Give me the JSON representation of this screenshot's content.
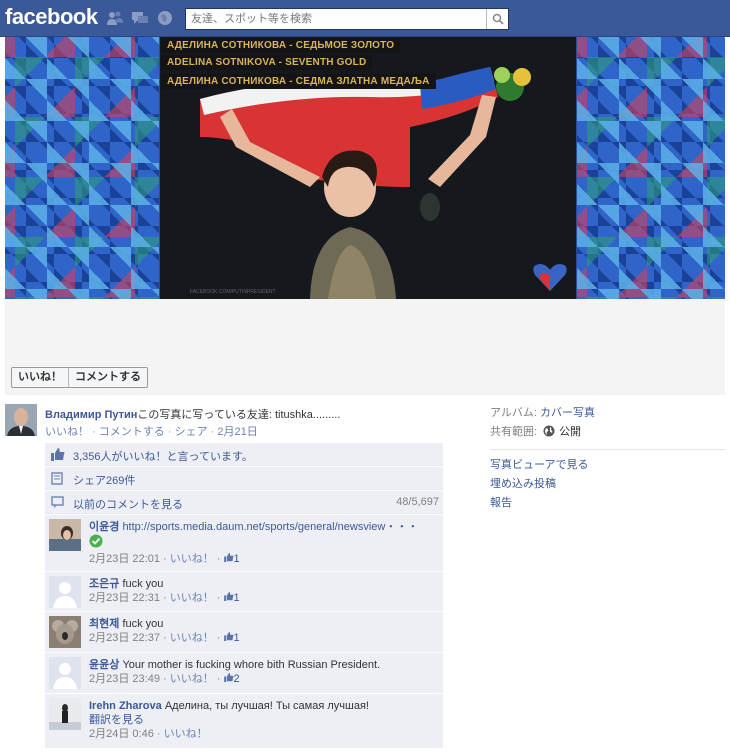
{
  "topbar": {
    "logo": "facebook",
    "search_placeholder": "友達、スポット等を検索",
    "jewels": [
      "friend-requests-icon",
      "messages-icon",
      "notifications-icon"
    ]
  },
  "photo": {
    "captions": [
      "АДЕЛИНА СОТНИКОВА - СЕДЬМОЕ ЗОЛОТО",
      "ADELINA SOTNIKOVA - SEVENTH GOLD",
      "АДЕЛИНА СОТНИКОВА - СЕДМА ЗЛАТНА МЕДАЉА"
    ],
    "watermark": "FACEBOOK.COM/PUTINPRESIDENT"
  },
  "actions": {
    "like": "いいね！",
    "comment": "コメントする"
  },
  "post": {
    "author": "Владимир Путин",
    "text": "この写真に写っている友達: titushka.........",
    "like": "いいね！",
    "comment": "コメントする",
    "share": "シェア",
    "date": "2月21日"
  },
  "ufi": {
    "likes": "3,356人がいいね！と言っています。",
    "shares": "シェア269件",
    "prev_comments": "以前のコメントを見る",
    "prev_count": "48/5,697"
  },
  "comments": [
    {
      "name": "이윤경",
      "text": "http://sports.media.daum.net/sports/general/newsview・・・",
      "time": "2月23日 22:01",
      "like": "いいね！",
      "likes": "1",
      "has_check": true
    },
    {
      "name": "조은규",
      "text": "fuck you",
      "time": "2月23日 22:31",
      "like": "いいね！",
      "likes": "1"
    },
    {
      "name": "최현제",
      "text": "fuck you",
      "time": "2月23日 22:37",
      "like": "いいね！",
      "likes": "1"
    },
    {
      "name": "윤윤상",
      "text": "Your mother is fucking whore bith Russian President.",
      "time": "2月23日 23:49",
      "like": "いいね！",
      "likes": "2"
    },
    {
      "name": "Irehn Zharova",
      "text": "Аделина, ты лучшая! Ты самая лучшая!",
      "translate": "翻訳を見る",
      "time": "2月24日 0:46",
      "like": "いいね！"
    }
  ],
  "sidebar": {
    "album_label": "アルバム:",
    "album_value": "カバー写真",
    "privacy_label": "共有範囲:",
    "privacy_value": "公開",
    "links": [
      "写真ビューアで見る",
      "埋め込み投稿",
      "報告"
    ]
  }
}
